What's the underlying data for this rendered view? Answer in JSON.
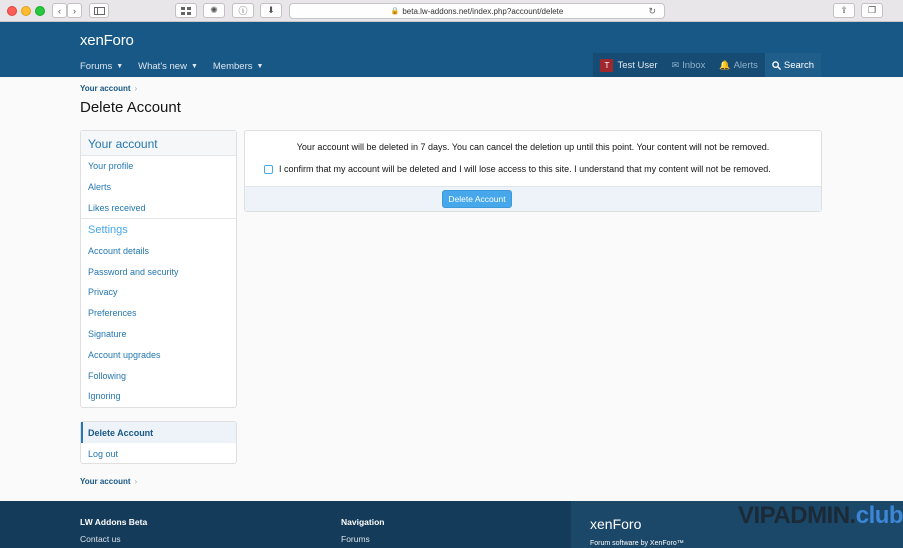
{
  "browser": {
    "url": "beta.lw-addons.net/index.php?account/delete",
    "back_icon": "chevron-left",
    "forward_icon": "chevron-right"
  },
  "header": {
    "logo_xen": "xen",
    "logo_foro": "Foro",
    "nav": [
      {
        "label": "Forums"
      },
      {
        "label": "What's new"
      },
      {
        "label": "Members"
      }
    ],
    "user": {
      "avatar_letter": "T",
      "name": "Test User",
      "inbox": "Inbox",
      "alerts": "Alerts",
      "search": "Search"
    }
  },
  "breadcrumb": {
    "label": "Your account"
  },
  "page_title": "Delete Account",
  "sidebar": {
    "heading": "Your account",
    "items": [
      "Your profile",
      "Alerts",
      "Likes received"
    ],
    "settings_heading": "Settings",
    "settings_items": [
      "Account details",
      "Password and security",
      "Privacy",
      "Preferences",
      "Signature",
      "Account upgrades",
      "Following",
      "Ignoring"
    ],
    "actions_active": "Delete Account",
    "actions_logout": "Log out"
  },
  "main": {
    "message": "Your account will be deleted in 7 days. You can cancel the deletion up until this point. Your content will not be removed.",
    "confirm_label": "I confirm that my account will be deleted and I will lose access to this site. I understand that my content will not be removed.",
    "confirm_checked": false,
    "button_label": "Delete Account"
  },
  "footer": {
    "col1_title": "LW Addons Beta",
    "col1_link": "Contact us",
    "col2_title": "Navigation",
    "col2_link": "Forums",
    "logo_xen": "xen",
    "logo_foro": "Foro",
    "credit": "Forum software by XenForo™",
    "watermark_a": "VIPADMIN.",
    "watermark_b": "club"
  },
  "colors": {
    "header": "#185886",
    "link": "#2577b1",
    "accent": "#47a7eb",
    "footer": "#143b59"
  }
}
